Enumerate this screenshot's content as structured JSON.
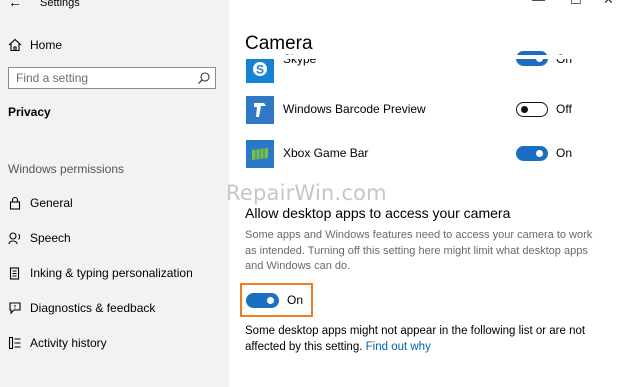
{
  "window": {
    "app_title": "Settings",
    "back_glyph": "←",
    "minimize_glyph": "—",
    "maximize_glyph": "☐",
    "close_glyph": "✕"
  },
  "sidebar": {
    "home_label": "Home",
    "search_placeholder": "Find a setting",
    "section_title": "Privacy",
    "group_title": "Windows permissions",
    "items": [
      {
        "label": "General",
        "icon": "lock-icon"
      },
      {
        "label": "Speech",
        "icon": "speech-icon"
      },
      {
        "label": "Inking & typing personalization",
        "icon": "clipboard-icon"
      },
      {
        "label": "Diagnostics & feedback",
        "icon": "feedback-icon"
      },
      {
        "label": "Activity history",
        "icon": "activity-history-icon"
      }
    ]
  },
  "main": {
    "page_title": "Camera",
    "apps": [
      {
        "name": "Skype",
        "state": "On",
        "on": true,
        "icon_color": "#1583d3"
      },
      {
        "name": "Windows Barcode Preview",
        "state": "Off",
        "on": false,
        "icon_color": "#2f78c4"
      },
      {
        "name": "Xbox Game Bar",
        "state": "On",
        "on": true,
        "icon_color": "#2a78c8"
      }
    ],
    "watermark": "RepairWin.com",
    "desktop_heading": "Allow desktop apps to access your camera",
    "desktop_desc": "Some apps and Windows features need to access your camera to work as intended. Turning off this setting here might limit what desktop apps and Windows can do.",
    "desktop_toggle_state": "On",
    "note_text": "Some desktop apps might not appear in the following list or are not affected by this setting. ",
    "note_link": "Find out why"
  },
  "colors": {
    "accent": "#1b6fc2",
    "highlight": "#ee7d1f",
    "link": "#0063b1",
    "sidebar_bg": "#f2f2f2"
  }
}
